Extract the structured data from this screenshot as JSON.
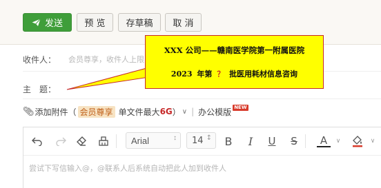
{
  "toolbar": {
    "send_label": "发送",
    "preview_label": "预 览",
    "draft_label": "存草稿",
    "cancel_label": "取 消"
  },
  "compose": {
    "to_label": "收件人：",
    "to_placeholder": "会员尊享，收件人上限",
    "subject_label": "主　题：",
    "attach_label": "添加附件",
    "attach_open_paren": "（",
    "vip_label": "会员尊享",
    "size_prefix": "单文件最大",
    "size_value": "6G",
    "attach_close_paren": "）",
    "office_template_label": "办公模版",
    "new_badge": "NEW"
  },
  "editor": {
    "font_name": "Arial",
    "font_size": "14",
    "bold_label": "B",
    "italic_label": "I",
    "underline_label": "U",
    "strike_label": "S",
    "font_color_label": "A",
    "placeholder": "尝试下写信输入@，@联系人后系统自动把此人加到收件人"
  },
  "callout": {
    "line1": "XXX 公司——赣南医学院第一附属医院",
    "line2_prefix": "2023 年第",
    "line2_mark": "？",
    "line2_suffix": "批医用耗材信息咨询"
  },
  "colors": {
    "send_green": "#3f9e3a",
    "callout_fill": "#ffff00",
    "callout_border": "#c62828",
    "vip_text": "#c0611b",
    "size_red": "#c62828"
  }
}
